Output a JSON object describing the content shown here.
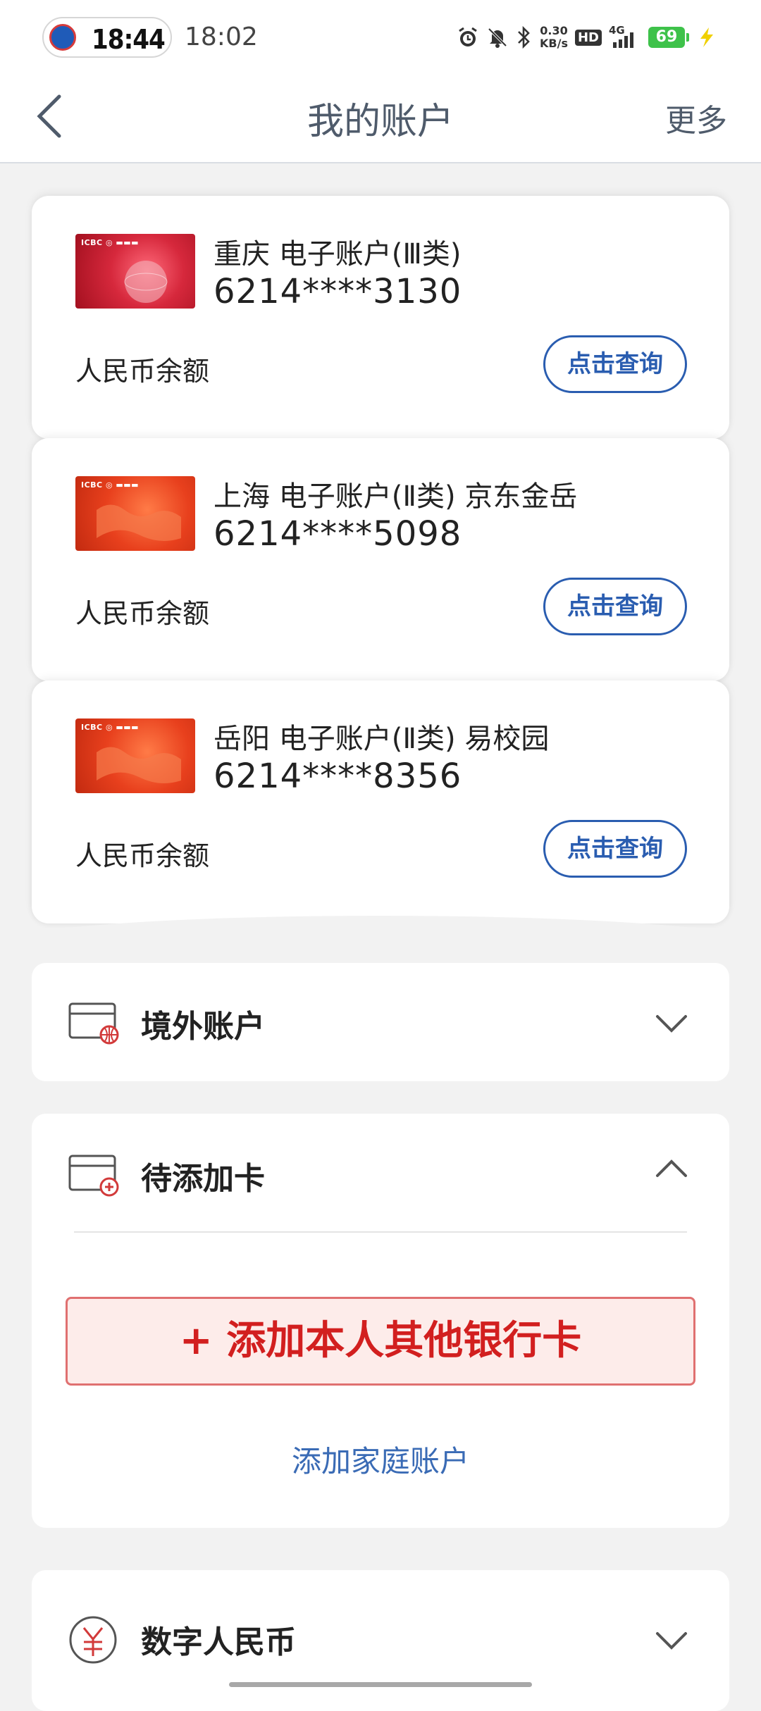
{
  "status_bar": {
    "pill_time": "18:44",
    "system_time": "18:02",
    "net_speed_value": "0.30",
    "net_speed_unit": "KB/s",
    "hd_label": "HD",
    "network_label": "4G",
    "battery_level": "69",
    "icons": [
      "alarm-icon",
      "bell-off-icon",
      "bluetooth-icon",
      "signal-icon",
      "charging-icon"
    ]
  },
  "nav": {
    "title": "我的账户",
    "more_label": "更多"
  },
  "accounts": [
    {
      "name": "重庆 电子账户(Ⅲ类)",
      "number": "6214****3130",
      "balance_label": "人民币余额",
      "query_label": "点击查询",
      "card_style": "pink"
    },
    {
      "name": "上海 电子账户(Ⅱ类) 京东金岳",
      "number": "6214****5098",
      "balance_label": "人民币余额",
      "query_label": "点击查询",
      "card_style": "orange"
    },
    {
      "name": "岳阳 电子账户(Ⅱ类) 易校园",
      "number": "6214****8356",
      "balance_label": "人民币余额",
      "query_label": "点击查询",
      "card_style": "orange"
    }
  ],
  "sections": {
    "overseas": {
      "title": "境外账户",
      "expanded": false
    },
    "pending": {
      "title": "待添加卡",
      "expanded": true,
      "add_bank_label": "+ 添加本人其他银行卡",
      "add_family_label": "添加家庭账户"
    },
    "digital_rmb": {
      "title": "数字人民币",
      "expanded": false
    }
  },
  "colors": {
    "accent_blue": "#2a5db0",
    "add_red": "#d21f1f",
    "nav_text": "#4f5b6b"
  }
}
